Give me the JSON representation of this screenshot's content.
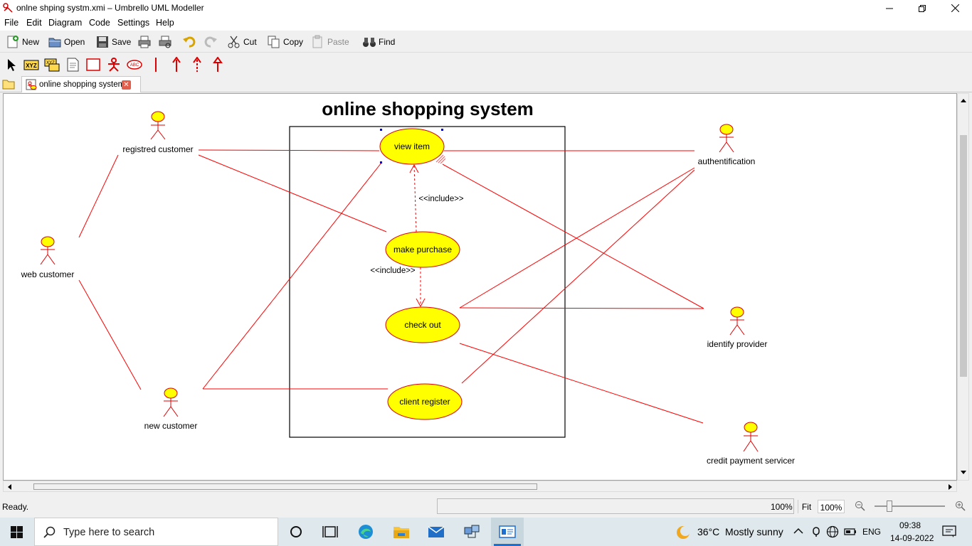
{
  "window": {
    "title": "onlne shping systm.xmi – Umbrello UML Modeller"
  },
  "menu": [
    "File",
    "Edit",
    "Diagram",
    "Code",
    "Settings",
    "Help"
  ],
  "toolbar": {
    "new": "New",
    "open": "Open",
    "save": "Save",
    "cut": "Cut",
    "copy": "Copy",
    "paste": "Paste",
    "find": "Find"
  },
  "tab": {
    "label": "online shopping system"
  },
  "diagram": {
    "title": "online shopping system",
    "use_cases": {
      "view_item": "view item",
      "make_purchase": "make purchase",
      "check_out": "check out",
      "client_register": "client register"
    },
    "actors": {
      "registred_customer": "registred customer",
      "web_customer": "web customer",
      "new_customer": "new customer",
      "authentification": "authentification",
      "identify_provider": "identify provider",
      "credit_payment_servicer": "credit payment servicer"
    },
    "include_label_1": "<<include>>",
    "include_label_2": "<<include>>",
    "colors": {
      "line": "#ff0000",
      "fill": "#ffff00"
    }
  },
  "status": {
    "text": "Ready.",
    "zoom1": "100%",
    "fit": "Fit",
    "zoom2": "100%"
  },
  "taskbar": {
    "search_placeholder": "Type here to search",
    "weather": "36°C  Mostly sunny",
    "lang": "ENG",
    "time": "09:38",
    "date": "14-09-2022"
  }
}
